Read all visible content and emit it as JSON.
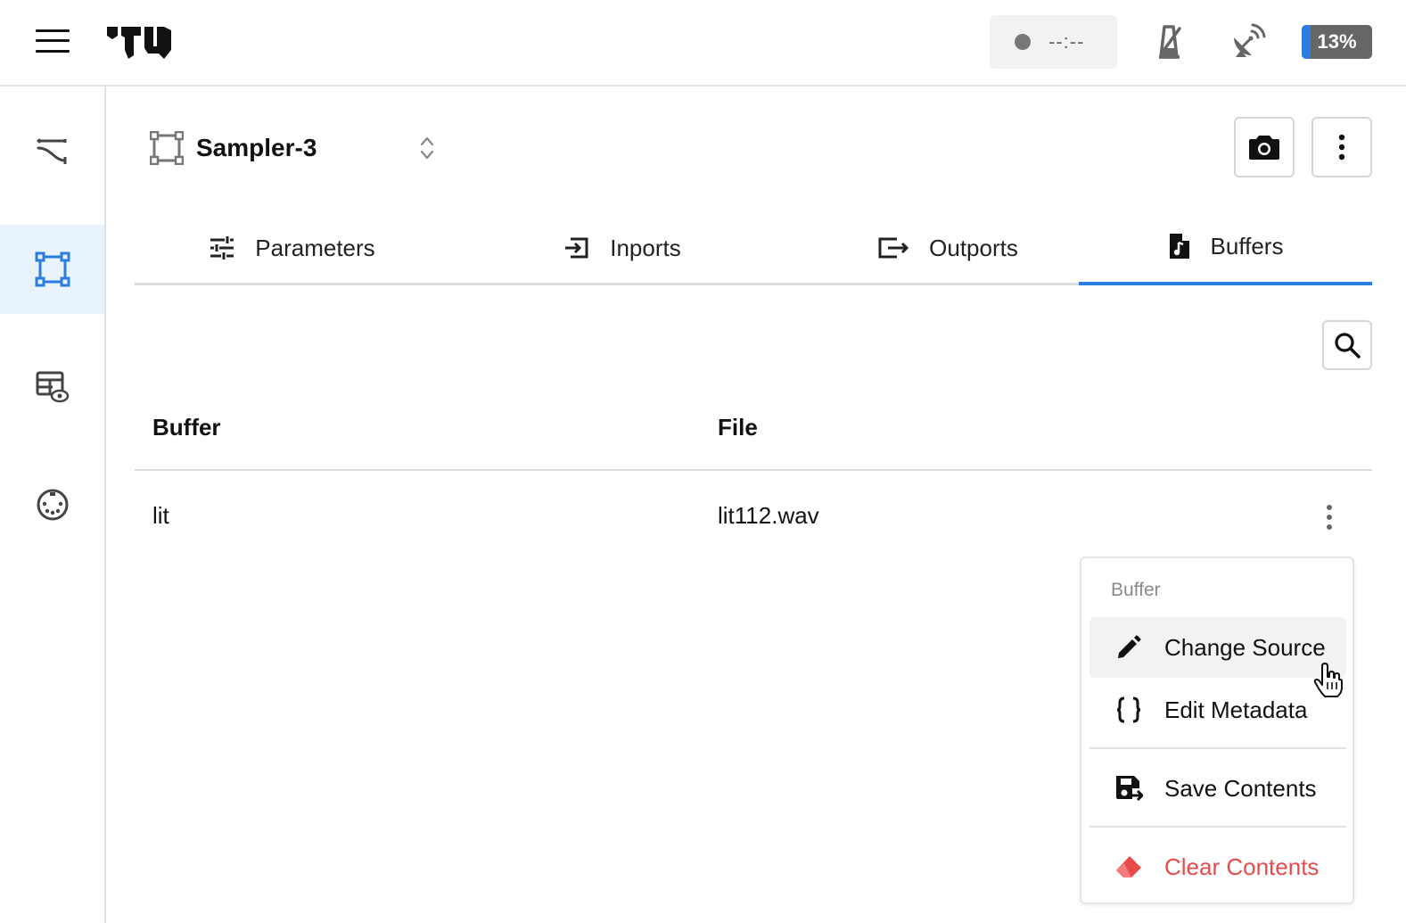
{
  "topbar": {
    "logo": "rnbo-logo",
    "status_time": "--:--",
    "cpu_label": "13%",
    "cpu_fraction": 0.13,
    "icons": [
      "menu-icon",
      "metronome-icon",
      "satellite-dish-icon"
    ]
  },
  "sidebar": {
    "items": [
      {
        "name": "graph",
        "icon": "graph-icon",
        "active": false
      },
      {
        "name": "devices",
        "icon": "device-icon",
        "active": true
      },
      {
        "name": "instance-view",
        "icon": "table-eye-icon",
        "active": false
      },
      {
        "name": "midi",
        "icon": "midi-port-icon",
        "active": false
      }
    ]
  },
  "device": {
    "name": "Sampler-3"
  },
  "tabs": [
    {
      "label": "Parameters",
      "icon": "sliders-icon",
      "active": false
    },
    {
      "label": "Inports",
      "icon": "login-icon",
      "active": false
    },
    {
      "label": "Outports",
      "icon": "logout-icon",
      "active": false
    },
    {
      "label": "Buffers",
      "icon": "file-music-icon",
      "active": true
    }
  ],
  "table": {
    "columns": [
      "Buffer",
      "File"
    ],
    "rows": [
      {
        "buffer": "lit",
        "file": "lit112.wav"
      }
    ]
  },
  "context_menu": {
    "title": "Buffer",
    "items": [
      {
        "label": "Change Source",
        "icon": "pencil-icon"
      },
      {
        "label": "Edit Metadata",
        "icon": "braces-icon"
      },
      {
        "label": "Save Contents",
        "icon": "save-icon"
      },
      {
        "label": "Clear Contents",
        "icon": "eraser-icon"
      }
    ]
  },
  "colors": {
    "accent": "#2a7de1",
    "danger": "#e94b4b",
    "active_bg": "#e9f3fd"
  }
}
